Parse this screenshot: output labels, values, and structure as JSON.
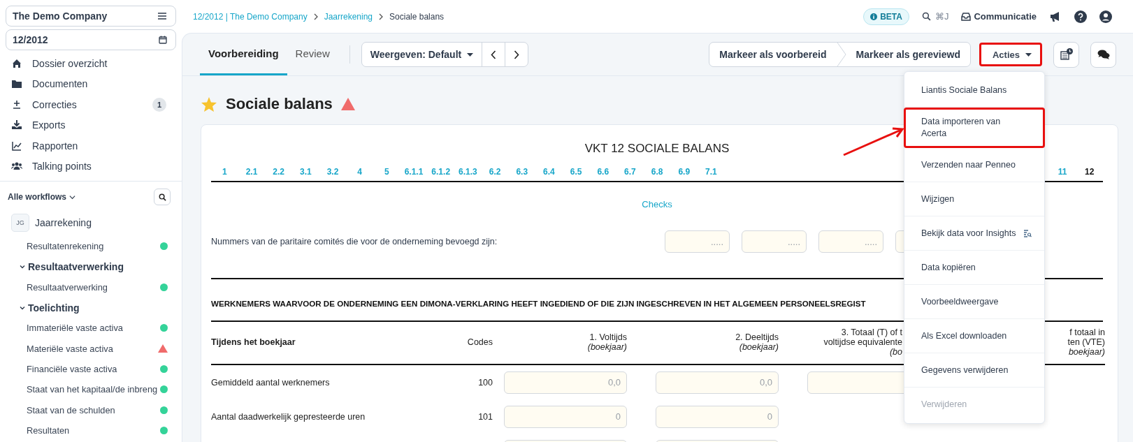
{
  "sidebar": {
    "company": "The Demo Company",
    "period": "12/2012",
    "nav": [
      {
        "label": "Dossier overzicht"
      },
      {
        "label": "Documenten"
      },
      {
        "label": "Correcties",
        "badge": "1"
      },
      {
        "label": "Exports"
      },
      {
        "label": "Rapporten"
      },
      {
        "label": "Talking points"
      }
    ],
    "workflows_filter": "Alle workflows",
    "workflow": {
      "initials": "JG",
      "label": "Jaarrekening",
      "children": [
        {
          "label": "Resultatenrekening",
          "warning": false
        },
        {
          "label": "Resultaatverwerking",
          "expanded": true,
          "children": [
            {
              "label": "Resultaatverwerking",
              "warning": false
            }
          ]
        },
        {
          "label": "Toelichting",
          "expanded": true,
          "children": [
            {
              "label": "Immateriële vaste activa",
              "warning": false
            },
            {
              "label": "Materiële vaste activa",
              "warning": true
            },
            {
              "label": "Financiële vaste activa",
              "warning": false
            },
            {
              "label": "Staat van het kapitaal/de inbreng",
              "warning": false
            },
            {
              "label": "Staat van de schulden",
              "warning": false
            },
            {
              "label": "Resultaten",
              "warning": false
            }
          ]
        }
      ]
    }
  },
  "header": {
    "breadcrumb": [
      {
        "label": "12/2012 | The Demo Company",
        "link": true
      },
      {
        "label": "Jaarrekening",
        "link": true
      },
      {
        "label": "Sociale balans",
        "link": false
      }
    ],
    "beta": "BETA",
    "search_shortcut": "⌘J",
    "communicatie": "Communicatie"
  },
  "toolbar": {
    "tabs": [
      {
        "label": "Voorbereiding",
        "selected": true
      },
      {
        "label": "Review",
        "selected": false
      }
    ],
    "view": "Weergeven: Default",
    "mark_buttons": [
      "Markeer als voorbereid",
      "Markeer als gereviewd"
    ],
    "actions": {
      "label": "Acties",
      "highlighted": true
    }
  },
  "page": {
    "title": "Sociale balans",
    "favorite": true,
    "warning": true
  },
  "form": {
    "title": "VKT 12 SOCIALE BALANS",
    "sections": [
      {
        "label": "1",
        "selected": false
      },
      {
        "label": "2.1",
        "selected": false
      },
      {
        "label": "2.2",
        "selected": false
      },
      {
        "label": "3.1",
        "selected": false
      },
      {
        "label": "3.2",
        "selected": false
      },
      {
        "label": "4",
        "selected": false
      },
      {
        "label": "5",
        "selected": false
      },
      {
        "label": "6.1.1",
        "selected": false
      },
      {
        "label": "6.1.2",
        "selected": false
      },
      {
        "label": "6.1.3",
        "selected": false
      },
      {
        "label": "6.2",
        "selected": false
      },
      {
        "label": "6.3",
        "selected": false
      },
      {
        "label": "6.4",
        "selected": false
      },
      {
        "label": "6.5",
        "selected": false
      },
      {
        "label": "6.6",
        "selected": false
      },
      {
        "label": "6.7",
        "selected": false
      },
      {
        "label": "6.8",
        "selected": false
      },
      {
        "label": "6.9",
        "selected": false
      },
      {
        "label": "7.1",
        "selected": false
      },
      {
        "label": "11",
        "selected": false
      },
      {
        "label": "12",
        "selected": true
      }
    ],
    "checks_link": "Checks",
    "comite": {
      "label": "Nummers van de paritaire comités die voor de onderneming bevoegd zijn:",
      "fields": [
        {
          "kind": "input",
          "placeholder": "....."
        },
        {
          "kind": "input",
          "placeholder": "....."
        },
        {
          "kind": "input",
          "placeholder": "....."
        },
        {
          "kind": "input"
        }
      ]
    },
    "heading": "WERKNEMERS WAARVOOR DE ONDERNEMING EEN DIMONA-VERKLARING HEEFT INGEDIEND OF DIE ZIJN INGESCHREVEN IN HET ALGEMEEN PERSONEELSREGIST",
    "columns": [
      {
        "lines": [
          "Tijdens het boekjaar"
        ]
      },
      {
        "lines": [
          "Codes"
        ]
      },
      {
        "lines": [
          "1. Voltijds"
        ],
        "sub": "(boekjaar)"
      },
      {
        "lines": [
          "2. Deeltijds"
        ],
        "sub": "(boekjaar)"
      },
      {
        "lines": [
          "3. Totaal (T) of t",
          "voltijdse equivalente"
        ],
        "sub": "(bo"
      },
      {
        "lines": [
          "f totaal in",
          "ten (VTE)"
        ],
        "sub": "boekjaar)"
      }
    ],
    "rows": [
      {
        "label": "Gemiddeld aantal werknemers",
        "code": "100",
        "fields": [
          {
            "kind": "input",
            "placeholder": "0,0"
          },
          {
            "kind": "input",
            "placeholder": "0,0"
          },
          {
            "kind": "input"
          }
        ]
      },
      {
        "label": "Aantal daadwerkelijk gepresteerde uren",
        "code": "101",
        "fields": [
          {
            "kind": "input",
            "placeholder": "0"
          },
          {
            "kind": "input",
            "placeholder": "0"
          }
        ]
      },
      {
        "fields": [
          {
            "kind": "input"
          },
          {
            "kind": "input"
          }
        ]
      }
    ]
  },
  "menu": {
    "items": [
      {
        "label": "Liantis Sociale Balans",
        "kind": "text",
        "highlighted": false,
        "disabled": false
      },
      {
        "label": "Data importeren van Acerta",
        "kind": "text",
        "highlighted": true,
        "disabled": false
      },
      {
        "label": "Verzenden naar Penneo",
        "kind": "text",
        "highlighted": false,
        "disabled": false
      },
      {
        "label": "Wijzigen",
        "kind": "text",
        "highlighted": false,
        "disabled": false
      },
      {
        "label": "Bekijk data voor Insights",
        "kind": "icon",
        "highlighted": false,
        "disabled": false
      },
      {
        "label": "Data kopiëren",
        "kind": "text",
        "highlighted": false,
        "disabled": false
      },
      {
        "label": "Voorbeeldweergave",
        "kind": "text",
        "highlighted": false,
        "disabled": false
      },
      {
        "label": "Als Excel downloaden",
        "kind": "text",
        "highlighted": false,
        "disabled": false
      },
      {
        "label": "Gegevens verwijderen",
        "kind": "text",
        "highlighted": false,
        "disabled": false
      },
      {
        "label": "Verwijderen",
        "kind": "text",
        "highlighted": false,
        "disabled": true
      }
    ]
  }
}
